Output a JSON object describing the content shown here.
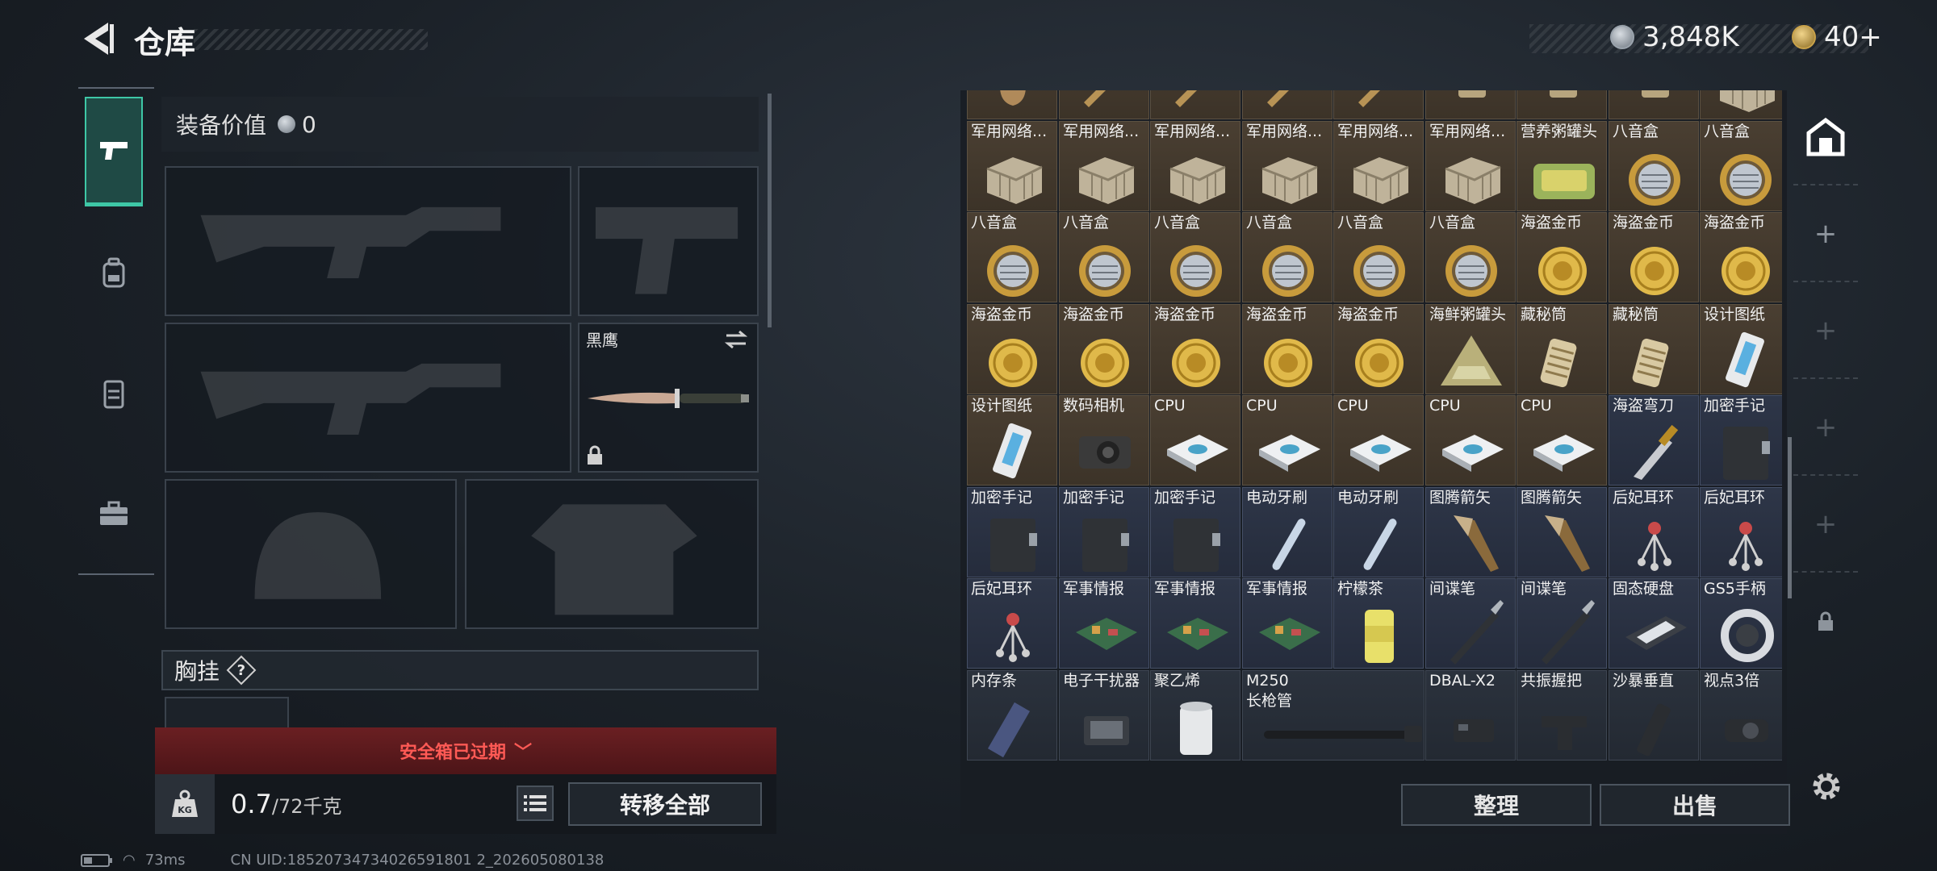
{
  "header": {
    "title": "仓库",
    "currency_main": "3,848K",
    "currency_token": "40+"
  },
  "left_tabs": [
    {
      "name": "weapons",
      "icon": "pistol-icon",
      "active": true
    },
    {
      "name": "backpack",
      "icon": "backpack-icon",
      "active": false
    },
    {
      "name": "vest",
      "icon": "vest-icon",
      "active": false
    },
    {
      "name": "toolbox",
      "icon": "briefcase-icon",
      "active": false
    }
  ],
  "equipment": {
    "value_label": "装备价值",
    "value": "0",
    "melee_name": "黑鹰",
    "chest_rig_label": "胸挂",
    "chest_rig_help": "?",
    "safe_box_expired": "安全箱已过期",
    "weight_current": "0.7",
    "weight_max": "/72千克",
    "transfer_all": "转移全部"
  },
  "stash": {
    "rows": [
      [
        {
          "name": "",
          "icon": "figurine",
          "tone": "gold"
        },
        {
          "name": "",
          "icon": "pen",
          "tone": "gold"
        },
        {
          "name": "",
          "icon": "pen",
          "tone": "gold"
        },
        {
          "name": "",
          "icon": "pen",
          "tone": "gold"
        },
        {
          "name": "",
          "icon": "pen",
          "tone": "gold"
        },
        {
          "name": "",
          "icon": "lighter",
          "tone": "gold"
        },
        {
          "name": "",
          "icon": "lighter",
          "tone": "gold"
        },
        {
          "name": "",
          "icon": "lighter",
          "tone": "gold"
        },
        {
          "name": "",
          "icon": "crate",
          "tone": "gold"
        }
      ],
      [
        {
          "name": "军用网络...",
          "icon": "crate",
          "tone": "gold"
        },
        {
          "name": "军用网络...",
          "icon": "crate",
          "tone": "gold"
        },
        {
          "name": "军用网络...",
          "icon": "crate",
          "tone": "gold"
        },
        {
          "name": "军用网络...",
          "icon": "crate",
          "tone": "gold"
        },
        {
          "name": "军用网络...",
          "icon": "crate",
          "tone": "gold"
        },
        {
          "name": "军用网络...",
          "icon": "crate",
          "tone": "gold"
        },
        {
          "name": "营养粥罐头",
          "icon": "tin",
          "tone": "gold"
        },
        {
          "name": "八音盒",
          "icon": "musicbox",
          "tone": "gold"
        },
        {
          "name": "八音盒",
          "icon": "musicbox",
          "tone": "gold"
        }
      ],
      [
        {
          "name": "八音盒",
          "icon": "musicbox",
          "tone": "gold"
        },
        {
          "name": "八音盒",
          "icon": "musicbox",
          "tone": "gold"
        },
        {
          "name": "八音盒",
          "icon": "musicbox",
          "tone": "gold"
        },
        {
          "name": "八音盒",
          "icon": "musicbox",
          "tone": "gold"
        },
        {
          "name": "八音盒",
          "icon": "musicbox",
          "tone": "gold"
        },
        {
          "name": "八音盒",
          "icon": "musicbox",
          "tone": "gold"
        },
        {
          "name": "海盗金币",
          "icon": "coin",
          "tone": "gold"
        },
        {
          "name": "海盗金币",
          "icon": "coin",
          "tone": "gold"
        },
        {
          "name": "海盗金币",
          "icon": "coin",
          "tone": "gold"
        }
      ],
      [
        {
          "name": "海盗金币",
          "icon": "coin",
          "tone": "gold"
        },
        {
          "name": "海盗金币",
          "icon": "coin",
          "tone": "gold"
        },
        {
          "name": "海盗金币",
          "icon": "coin",
          "tone": "gold"
        },
        {
          "name": "海盗金币",
          "icon": "coin",
          "tone": "gold"
        },
        {
          "name": "海盗金币",
          "icon": "coin",
          "tone": "gold"
        },
        {
          "name": "海鲜粥罐头",
          "icon": "tri-can",
          "tone": "gold"
        },
        {
          "name": "藏秘筒",
          "icon": "cryptex",
          "tone": "gold"
        },
        {
          "name": "藏秘筒",
          "icon": "cryptex",
          "tone": "gold"
        },
        {
          "name": "设计图纸",
          "icon": "blueprint",
          "tone": "gold"
        }
      ],
      [
        {
          "name": "设计图纸",
          "icon": "blueprint",
          "tone": "gold"
        },
        {
          "name": "数码相机",
          "icon": "camera",
          "tone": "gold"
        },
        {
          "name": "CPU",
          "icon": "cpu",
          "tone": "gold"
        },
        {
          "name": "CPU",
          "icon": "cpu",
          "tone": "gold"
        },
        {
          "name": "CPU",
          "icon": "cpu",
          "tone": "gold"
        },
        {
          "name": "CPU",
          "icon": "cpu",
          "tone": "gold"
        },
        {
          "name": "CPU",
          "icon": "cpu",
          "tone": "gold"
        },
        {
          "name": "海盗弯刀",
          "icon": "dagger",
          "tone": "blue"
        },
        {
          "name": "加密手记",
          "icon": "notebook",
          "tone": "blue"
        }
      ],
      [
        {
          "name": "加密手记",
          "icon": "notebook",
          "tone": "blue"
        },
        {
          "name": "加密手记",
          "icon": "notebook",
          "tone": "blue"
        },
        {
          "name": "加密手记",
          "icon": "notebook",
          "tone": "blue"
        },
        {
          "name": "电动牙刷",
          "icon": "toothbrush",
          "tone": "blue"
        },
        {
          "name": "电动牙刷",
          "icon": "toothbrush",
          "tone": "blue"
        },
        {
          "name": "图腾箭矢",
          "icon": "arrow",
          "tone": "blue"
        },
        {
          "name": "图腾箭矢",
          "icon": "arrow",
          "tone": "blue"
        },
        {
          "name": "后妃耳环",
          "icon": "earring",
          "tone": "blue"
        },
        {
          "name": "后妃耳环",
          "icon": "earring",
          "tone": "blue"
        }
      ],
      [
        {
          "name": "后妃耳环",
          "icon": "earring",
          "tone": "blue"
        },
        {
          "name": "军事情报",
          "icon": "circuit",
          "tone": "blue"
        },
        {
          "name": "军事情报",
          "icon": "circuit",
          "tone": "blue"
        },
        {
          "name": "军事情报",
          "icon": "circuit",
          "tone": "blue"
        },
        {
          "name": "柠檬茶",
          "icon": "can",
          "tone": "blue"
        },
        {
          "name": "间谍笔",
          "icon": "spypen",
          "tone": "blue"
        },
        {
          "name": "间谍笔",
          "icon": "spypen",
          "tone": "blue"
        },
        {
          "name": "固态硬盘",
          "icon": "ssd",
          "tone": "blue"
        },
        {
          "name": "GS5手柄",
          "icon": "controller",
          "tone": "blue"
        }
      ],
      [
        {
          "name": "内存条",
          "icon": "ram",
          "tone": "dark"
        },
        {
          "name": "电子干扰器",
          "icon": "jammer",
          "tone": "dark"
        },
        {
          "name": "聚乙烯",
          "icon": "roll",
          "tone": "dark"
        },
        {
          "name": "M250",
          "name2": "长枪管",
          "icon": "barrel",
          "tone": "dark",
          "span": 2
        },
        {
          "name": "DBAL-X2",
          "icon": "laser",
          "tone": "dark"
        },
        {
          "name": "共振握把",
          "icon": "grip",
          "tone": "dark"
        },
        {
          "name": "沙暴垂直",
          "icon": "vgrip",
          "tone": "dark"
        },
        {
          "name": "视点3倍",
          "icon": "scope",
          "tone": "dark"
        }
      ]
    ],
    "sort_label": "整理",
    "sell_label": "出售"
  },
  "status": {
    "battery_level": 0.35,
    "ping": "73ms",
    "uid": "CN UID:18520734734026591801 2_202605080138"
  },
  "colors": {
    "accent": "#3ec7a6",
    "expired": "#ff5a55",
    "gold_cell": "#4a3f32",
    "blue_cell": "#2e3648"
  }
}
